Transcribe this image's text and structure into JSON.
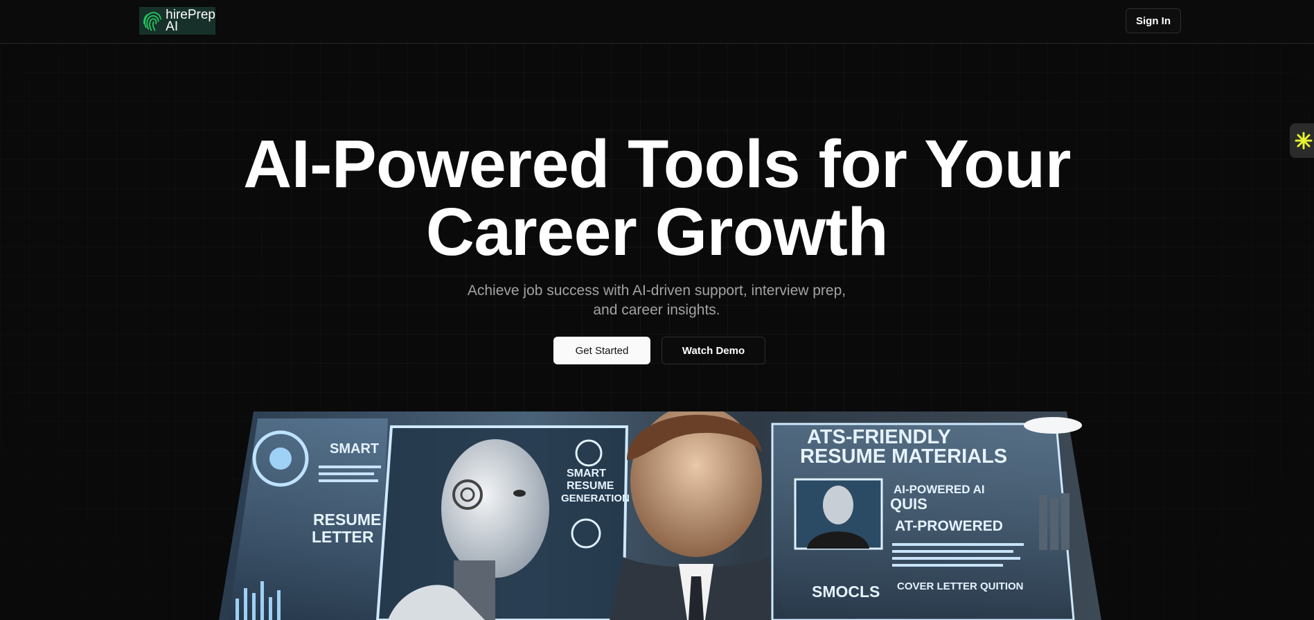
{
  "header": {
    "logo_line1": "hirePrep",
    "logo_line2": "AI",
    "sign_in_label": "Sign In"
  },
  "hero": {
    "title_line1": "AI-Powered Tools for Your",
    "title_line2": "Career Growth",
    "subtitle_line1": "Achieve job success with AI-driven support, interview prep,",
    "subtitle_line2": "and career insights.",
    "primary_cta": "Get Started",
    "secondary_cta": "Watch Demo"
  },
  "hero_image": {
    "labels": {
      "smart": "SMART",
      "resume_letter_1": "RESUME",
      "resume_letter_2": "LETTER",
      "smart_resume_1": "SMART",
      "smart_resume_2": "RESUME",
      "smart_resume_3": "GENERATION",
      "ats_1": "ATS-FRIENDLY",
      "ats_2": "RESUME MATERIALS",
      "ai_powered": "AI-POWERED AI",
      "quis": "QUIS",
      "at_prowered": "AT-PROWERED",
      "smocls": "SMOCLS",
      "cover_letter": "COVER LETTER QUITION"
    }
  },
  "colors": {
    "background": "#0a0a0a",
    "logo_bg": "#17312a",
    "logo_accent": "#22c55e",
    "widget_accent": "#e5f22e"
  }
}
